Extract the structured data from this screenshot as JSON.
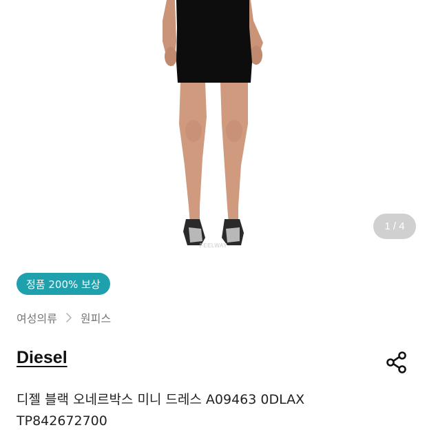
{
  "gallery": {
    "watermark": "FEELWAY",
    "page_indicator": "1 / 4",
    "image_icon": "product-photo-dress"
  },
  "badge": {
    "label": "정품 200% 보상"
  },
  "breadcrumb": {
    "items": [
      "여성의류",
      "원피스"
    ],
    "separator_icon": "chevron-right-icon"
  },
  "product": {
    "brand": "Diesel",
    "title_line1": "디젤 블랙 오네르박스 미니 드레스 A09463 0DLAX",
    "title_line2": "TP842672700"
  },
  "actions": {
    "share_icon": "share-icon"
  },
  "colors": {
    "badge_bg": "#1fa1ad",
    "indicator_bg": "#aaaaaa",
    "text_primary": "#222222",
    "text_secondary": "#777777"
  }
}
